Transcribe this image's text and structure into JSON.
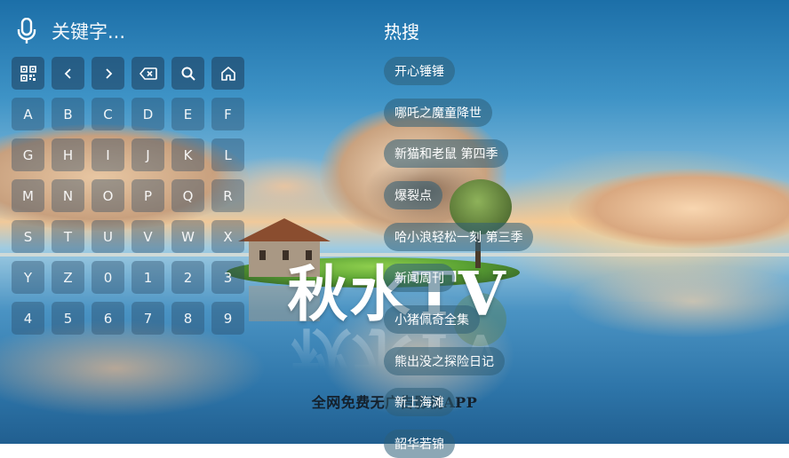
{
  "search": {
    "placeholder": "关键字..."
  },
  "keyboard": {
    "function_keys": [
      {
        "icon": "qr-code-icon"
      },
      {
        "icon": "chevron-left-icon"
      },
      {
        "icon": "chevron-right-icon"
      },
      {
        "icon": "backspace-icon"
      },
      {
        "icon": "search-icon"
      },
      {
        "icon": "home-icon"
      }
    ],
    "rows": [
      [
        "A",
        "B",
        "C",
        "D",
        "E",
        "F"
      ],
      [
        "G",
        "H",
        "I",
        "J",
        "K",
        "L"
      ],
      [
        "M",
        "N",
        "O",
        "P",
        "Q",
        "R"
      ],
      [
        "S",
        "T",
        "U",
        "V",
        "W",
        "X"
      ],
      [
        "Y",
        "Z",
        "0",
        "1",
        "2",
        "3"
      ],
      [
        "4",
        "5",
        "6",
        "7",
        "8",
        "9"
      ]
    ]
  },
  "hot_search": {
    "title": "热搜",
    "items": [
      "开心锤锤",
      "哪吒之魔童降世",
      "新猫和老鼠 第四季",
      "爆裂点",
      "哈小浪轻松一刻 第三季",
      "新闻周刊",
      "小猪佩奇全集",
      "熊出没之探险日记",
      "新上海滩",
      "韶华若锦"
    ]
  },
  "watermark": {
    "title": "秋水TV",
    "subtitle": "全网免费无广告影视APP"
  },
  "colors": {
    "key_bg": "#28465f",
    "chip_bg": "#2d5f78",
    "text": "#ffffff"
  }
}
